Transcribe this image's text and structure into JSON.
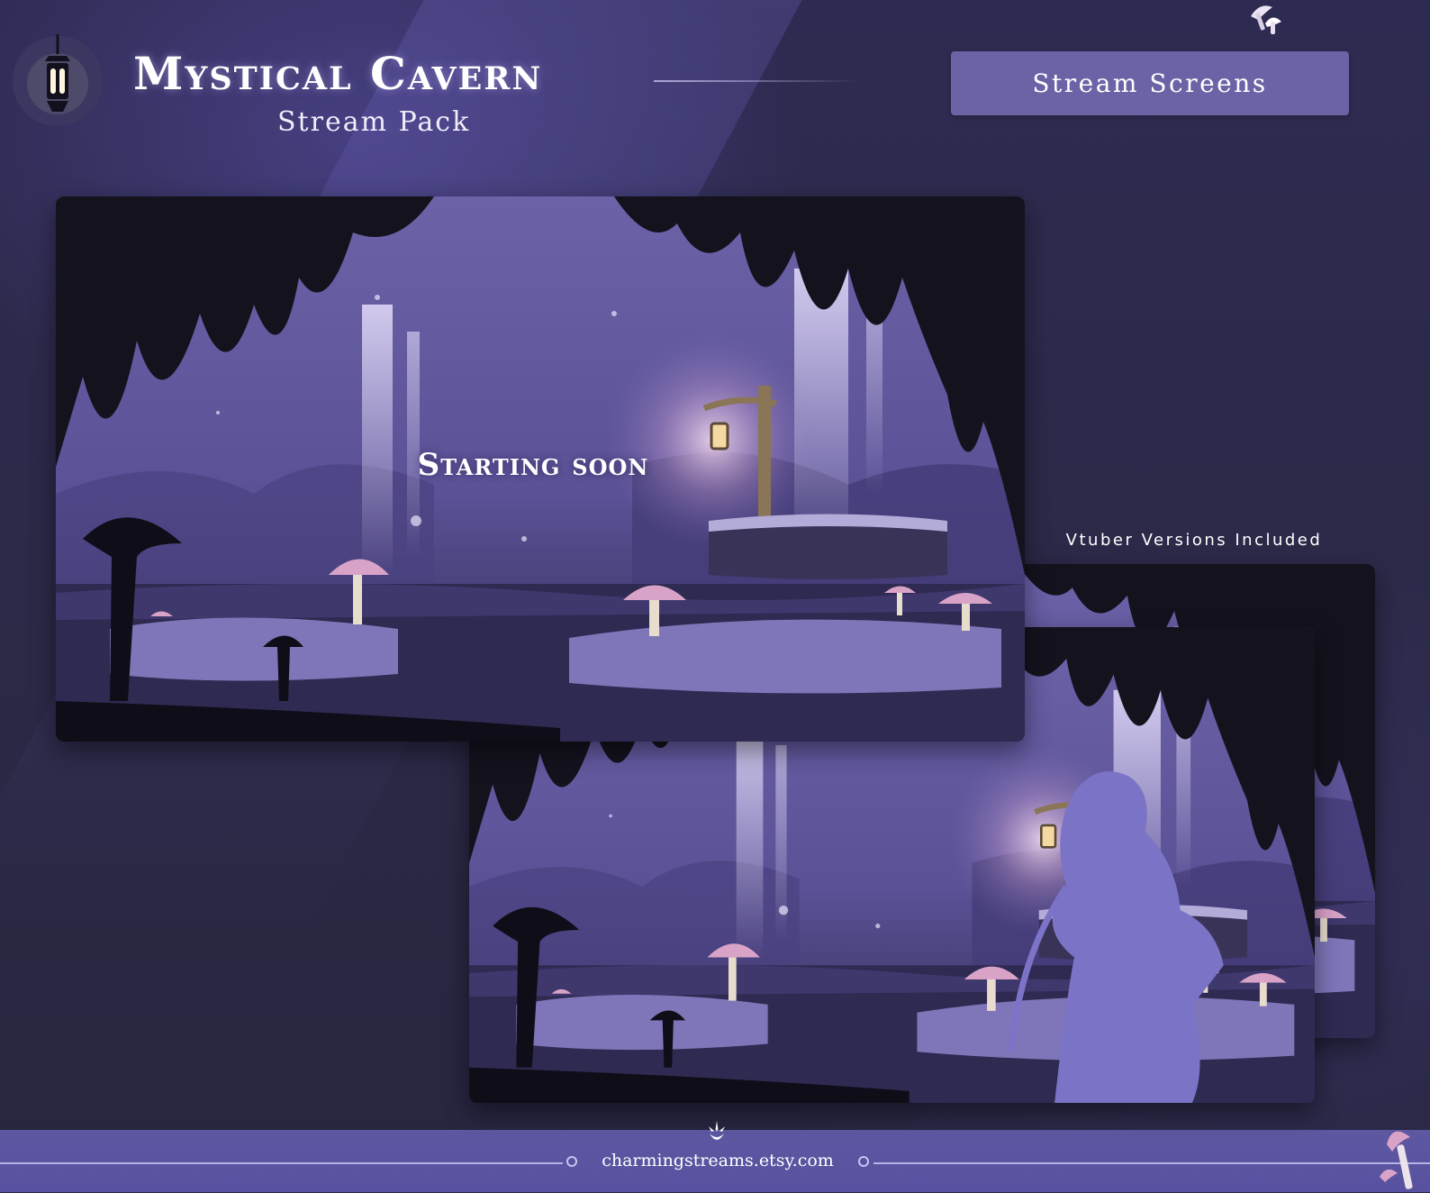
{
  "header": {
    "title": "Mystical Cavern",
    "subtitle": "Stream Pack",
    "section_label": "Stream Screens"
  },
  "screens": {
    "main_overlay_text": "Starting soon",
    "vtuber_label": "Vtuber Versions Included"
  },
  "footer": {
    "url": "charmingstreams.etsy.com"
  },
  "icons": {
    "header_left": "lantern-icon",
    "top_right": "mushroom-icon",
    "footer_center": "moon-emblem-icon",
    "footer_corner": "mushroom-icon"
  },
  "colors": {
    "background": "#2b2946",
    "badge": "#6a64a6",
    "footer": "#5751a0",
    "mushroom_pink": "#d9a3c8"
  }
}
